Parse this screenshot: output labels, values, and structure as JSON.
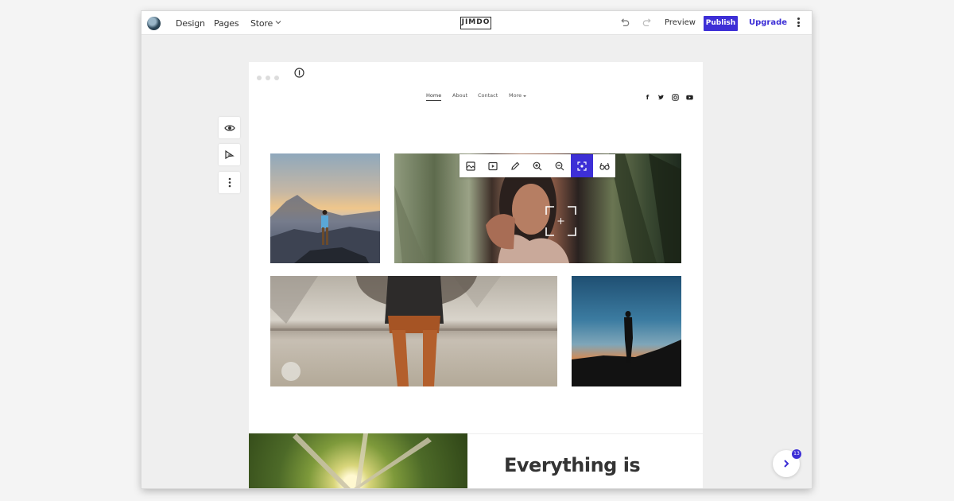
{
  "topbar": {
    "nav": [
      "Design",
      "Pages",
      "Store"
    ],
    "logo": "JIMDO",
    "preview_label": "Preview",
    "publish_label": "Publish",
    "upgrade_label": "Upgrade"
  },
  "site": {
    "nav": [
      "Home",
      "About",
      "Contact",
      "More"
    ],
    "social": [
      "facebook-icon",
      "twitter-icon",
      "instagram-icon",
      "youtube-icon"
    ],
    "headline": "Everything is"
  },
  "image_toolbar": {
    "tools": [
      "replace-image-icon",
      "slideshow-icon",
      "edit-pencil-icon",
      "zoom-in-icon",
      "zoom-out-icon",
      "focus-point-icon",
      "alt-text-glasses-icon"
    ],
    "active_tool": "focus-point-icon"
  },
  "help": {
    "badge": "13"
  },
  "colors": {
    "accent": "#3d2fd6"
  }
}
